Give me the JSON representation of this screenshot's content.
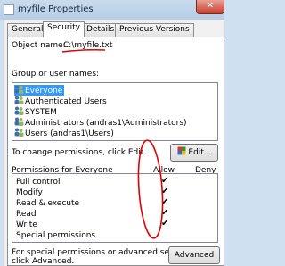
{
  "window": {
    "title": "myfile Properties",
    "close_label": "✕"
  },
  "tabs": [
    {
      "label": "General",
      "active": false
    },
    {
      "label": "Security",
      "active": true
    },
    {
      "label": "Details",
      "active": false
    },
    {
      "label": "Previous Versions",
      "active": false
    }
  ],
  "object": {
    "label": "Object name:",
    "value": "C:\\myfile.txt"
  },
  "groups": {
    "label": "Group or user names:",
    "items": [
      {
        "name": "Everyone",
        "selected": true
      },
      {
        "name": "Authenticated Users",
        "selected": false
      },
      {
        "name": "SYSTEM",
        "selected": false
      },
      {
        "name": "Administrators (andras1\\Administrators)",
        "selected": false
      },
      {
        "name": "Users (andras1\\Users)",
        "selected": false
      }
    ]
  },
  "change_text": "To change permissions, click Edit.",
  "edit_button": "Edit...",
  "permissions": {
    "header": "Permissions for Everyone",
    "allow_label": "Allow",
    "deny_label": "Deny",
    "rows": [
      {
        "name": "Full control",
        "allow": true,
        "deny": false
      },
      {
        "name": "Modify",
        "allow": true,
        "deny": false
      },
      {
        "name": "Read & execute",
        "allow": true,
        "deny": false
      },
      {
        "name": "Read",
        "allow": true,
        "deny": false
      },
      {
        "name": "Write",
        "allow": true,
        "deny": false
      },
      {
        "name": "Special permissions",
        "allow": false,
        "deny": false
      }
    ],
    "check_glyph": "✔"
  },
  "footer": {
    "text_line1": "For special permissions or advanced settings,",
    "text_line2": "click Advanced.",
    "advanced_button": "Advanced"
  },
  "colors": {
    "selection": "#3399ff",
    "annotation": "#e00000"
  }
}
